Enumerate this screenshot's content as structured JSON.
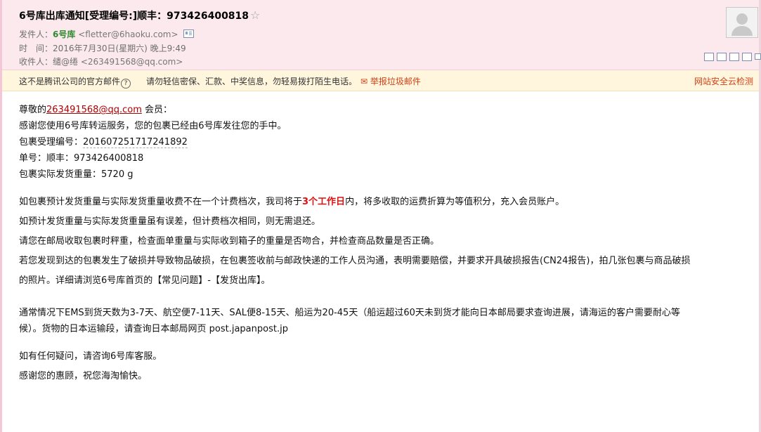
{
  "email": {
    "subject": "6号库出库通知[受理编号:]顺丰：973426400818",
    "sender_label": "发件人：",
    "sender_name": "6号库",
    "sender_addr": "<fletter@6haoku.com>",
    "time_label": "时　间：",
    "time_value": "2016年7月30日(星期六) 晚上9:49",
    "recipient_label": "收件人：",
    "recipient_name": "缱@绻",
    "recipient_addr": "<263491568@qq.com>"
  },
  "warning": {
    "text1": "这不是腾讯公司的官方邮件",
    "help": "?",
    "text2": "请勿轻信密保、汇款、中奖信息，勿轻易拨打陌生电话。",
    "report_label": "举报垃圾邮件",
    "security_label": "网站安全云检测"
  },
  "body": {
    "greeting_prefix": "尊敬的",
    "greeting_email": "263491568@qq.com",
    "greeting_suffix": " 会员：",
    "line1": "感谢您使用6号库转运服务，您的包裹已经由6号库发往您的手中。",
    "line2_prefix": "包裹受理编号：",
    "line2_value": "201607251717241892",
    "line3": "单号：顺丰：973426400818",
    "line4": "包裹实际发货重量：5720 g",
    "p1_prefix": "如包裹预计发货重量与实际发货重量收费不在一个计费档次，我司将于",
    "p1_highlight": "3个工作日",
    "p1_suffix": "内，将多收取的运费折算为等值积分，充入会员账户。",
    "p2": "如预计发货重量与实际发货重量虽有误差，但计费档次相同，则无需退还。",
    "p3": "请您在邮局收取包裹时秤重，检查面单重量与实际收到箱子的重量是否吻合，并检查商品数量是否正确。",
    "p4a": "若您发现到达的包裹发生了破损并导致物品破损，在包裹签收前与邮政快递的工作人员沟通，表明需要赔偿，并要求开具破损报告(CN24报告)，拍几张包裹与商品破损",
    "p4b": "的照片。详细请浏览6号库首页的【常见问题】-【发货出库】。",
    "p5a": "通常情况下EMS到货天数为3-7天、航空便7-11天、SAL便8-15天、船运为20-45天（船运超过60天未到货才能向日本邮局要求查询进展，请海运的客户需要耐心等",
    "p5b": "候）。货物的日本运输段，请查询日本邮局网页 post.japanpost.jp",
    "p6": "如有任何疑问，请咨询6号库客服。",
    "p7": "感谢您的惠顾，祝您海淘愉快。"
  },
  "icons": [
    "star-icon",
    "contact-card-icon",
    "avatar-icon",
    "toolbar-icons",
    "report-icon",
    "help-icon"
  ],
  "colors": {
    "header_bg": "#fce9ee",
    "warning_bg": "#fff6dd",
    "accent_red": "#d04016",
    "highlight_red": "#e01010",
    "sender_green": "#2f8a2f"
  }
}
